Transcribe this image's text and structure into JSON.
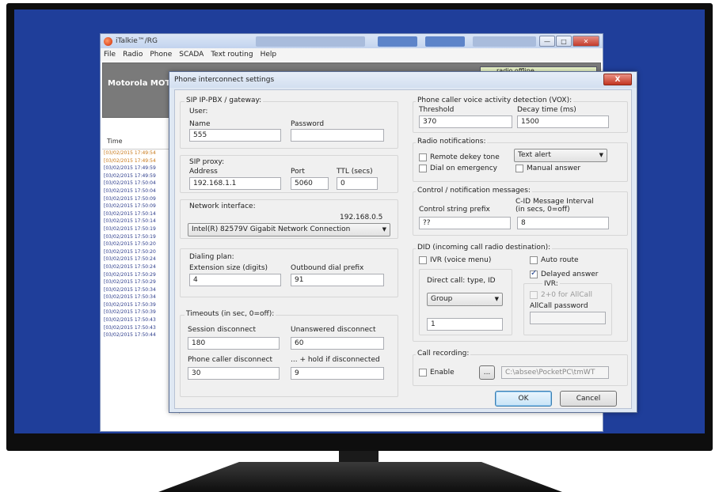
{
  "app": {
    "title": "iTalkie™/RG",
    "menu": [
      "File",
      "Radio",
      "Phone",
      "SCADA",
      "Text routing",
      "Help"
    ],
    "brand": "Motorola MOTO",
    "radio_status": "radio offline",
    "log_header": "Time",
    "log_rows": [
      "[03/02/2015 17:49:54",
      "[03/02/2015 17:49:54",
      "[03/02/2015 17:49:59",
      "[03/02/2015 17:49:59",
      "[03/02/2015 17:50:04",
      "[03/02/2015 17:50:04",
      "[03/02/2015 17:50:09",
      "[03/02/2015 17:50:09",
      "[03/02/2015 17:50:14",
      "[03/02/2015 17:50:14",
      "[03/02/2015 17:50:19",
      "[03/02/2015 17:50:19",
      "[03/02/2015 17:50:20",
      "[03/02/2015 17:50:20",
      "[03/02/2015 17:50:24",
      "[03/02/2015 17:50:24",
      "[03/02/2015 17:50:29",
      "[03/02/2015 17:50:29",
      "[03/02/2015 17:50:34",
      "[03/02/2015 17:50:34",
      "[03/02/2015 17:50:39",
      "[03/02/2015 17:50:39",
      "[03/02/2015 17:50:43",
      "[03/02/2015 17:50:43",
      "[03/02/2015 17:50:44"
    ]
  },
  "dialog": {
    "title": "Phone interconnect settings",
    "close_label": "X",
    "sip": {
      "group_label": "SIP IP-PBX / gateway:",
      "user_label": "User:",
      "name_label": "Name",
      "name_value": "555",
      "password_label": "Password",
      "password_value": "",
      "proxy_label": "SIP proxy:",
      "address_label": "Address",
      "address_value": "192.168.1.1",
      "port_label": "Port",
      "port_value": "5060",
      "ttl_label": "TTL (secs)",
      "ttl_value": "0"
    },
    "network": {
      "label": "Network interface:",
      "ip": "192.168.0.5",
      "adapter": "Intel(R) 82579V Gigabit Network Connection"
    },
    "dialing": {
      "label": "Dialing plan:",
      "ext_label": "Extension size (digits)",
      "ext_value": "4",
      "prefix_label": "Outbound dial prefix",
      "prefix_value": "91"
    },
    "timeouts": {
      "label": "Timeouts (in sec, 0=off):",
      "session_label": "Session disconnect",
      "session_value": "180",
      "unanswered_label": "Unanswered disconnect",
      "unanswered_value": "60",
      "caller_label": "Phone caller disconnect",
      "caller_value": "30",
      "hold_label": "... + hold if disconnected",
      "hold_value": "9"
    },
    "vox": {
      "label": "Phone caller voice activity detection (VOX):",
      "threshold_label": "Threshold",
      "threshold_value": "370",
      "decay_label": "Decay time (ms)",
      "decay_value": "1500"
    },
    "radio_notifications": {
      "label": "Radio notifications:",
      "remote_dekey": "Remote dekey tone",
      "remote_dekey_checked": false,
      "dial_emergency": "Dial on emergency",
      "dial_emergency_checked": false,
      "alert_option": "Text alert",
      "manual_answer": "Manual answer",
      "manual_answer_checked": false
    },
    "control": {
      "label": "Control / notification messages:",
      "prefix_label": "Control string prefix",
      "prefix_value": "??",
      "cid_label_1": "C-ID Message Interval",
      "cid_label_2": "(in secs, 0=off)",
      "cid_value": "8"
    },
    "did": {
      "label": "DID (incoming call radio destination):",
      "ivr": "IVR (voice menu)",
      "ivr_checked": false,
      "auto_route": "Auto route",
      "auto_route_checked": false,
      "direct_call_label": "Direct call: type, ID",
      "call_type": "Group",
      "call_id": "1",
      "delayed_answer": "Delayed answer",
      "delayed_answer_checked": true,
      "ivr_sub_label": "IVR:",
      "allcall_option": "2+0 for AllCall",
      "allcall_checked": false,
      "allcall_password_label": "AllCall password",
      "allcall_password": ""
    },
    "recording": {
      "label": "Call recording:",
      "enable": "Enable",
      "enable_checked": false,
      "browse_label": "...",
      "path": "C:\\absee\\PocketPC\\tmWT"
    },
    "ok_label": "OK",
    "cancel_label": "Cancel"
  }
}
